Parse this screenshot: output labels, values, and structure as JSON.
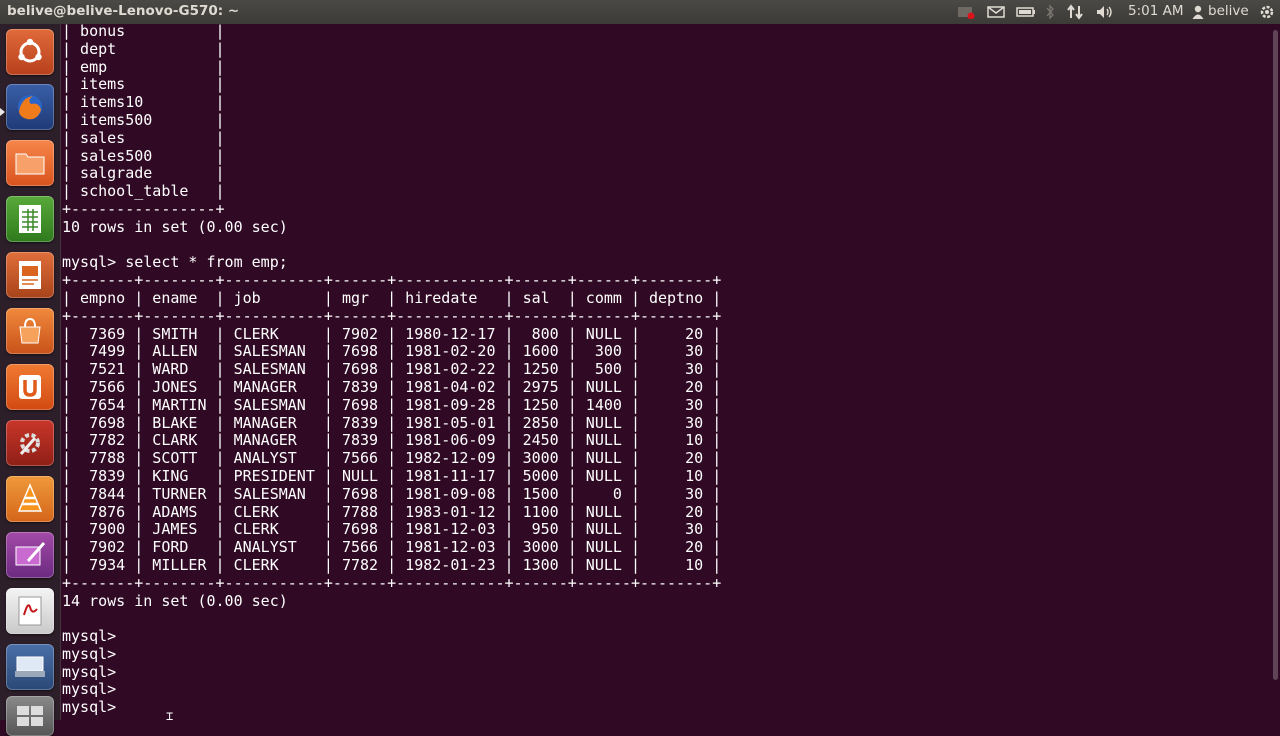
{
  "window_title": "belive@belive-Lenovo-G570: ~",
  "panel": {
    "clock": "5:01 AM",
    "user": "belive"
  },
  "launcher": [
    "ubuntu-dash",
    "firefox",
    "files",
    "libreoffice-calc",
    "libreoffice-impress",
    "ubuntu-software-center",
    "ubuntu-one",
    "system-settings",
    "vlc",
    "kdenlive",
    "document-viewer",
    "scanner",
    "workspace-switcher"
  ],
  "terminal": {
    "lines": [
      "| bonus          |",
      "| dept           |",
      "| emp            |",
      "| items          |",
      "| items10        |",
      "| items500       |",
      "| sales          |",
      "| sales500       |",
      "| salgrade       |",
      "| school_table   |",
      "+----------------+",
      "10 rows in set (0.00 sec)",
      "",
      "mysql> select * from emp;",
      "+-------+--------+-----------+------+------------+------+------+--------+",
      "| empno | ename  | job       | mgr  | hiredate   | sal  | comm | deptno |",
      "+-------+--------+-----------+------+------------+------+------+--------+",
      "|  7369 | SMITH  | CLERK     | 7902 | 1980-12-17 |  800 | NULL |     20 |",
      "|  7499 | ALLEN  | SALESMAN  | 7698 | 1981-02-20 | 1600 |  300 |     30 |",
      "|  7521 | WARD   | SALESMAN  | 7698 | 1981-02-22 | 1250 |  500 |     30 |",
      "|  7566 | JONES  | MANAGER   | 7839 | 1981-04-02 | 2975 | NULL |     20 |",
      "|  7654 | MARTIN | SALESMAN  | 7698 | 1981-09-28 | 1250 | 1400 |     30 |",
      "|  7698 | BLAKE  | MANAGER   | 7839 | 1981-05-01 | 2850 | NULL |     30 |",
      "|  7782 | CLARK  | MANAGER   | 7839 | 1981-06-09 | 2450 | NULL |     10 |",
      "|  7788 | SCOTT  | ANALYST   | 7566 | 1982-12-09 | 3000 | NULL |     20 |",
      "|  7839 | KING   | PRESIDENT | NULL | 1981-11-17 | 5000 | NULL |     10 |",
      "|  7844 | TURNER | SALESMAN  | 7698 | 1981-09-08 | 1500 |    0 |     30 |",
      "|  7876 | ADAMS  | CLERK     | 7788 | 1983-01-12 | 1100 | NULL |     20 |",
      "|  7900 | JAMES  | CLERK     | 7698 | 1981-12-03 |  950 | NULL |     30 |",
      "|  7902 | FORD   | ANALYST   | 7566 | 1981-12-03 | 3000 | NULL |     20 |",
      "|  7934 | MILLER | CLERK     | 7782 | 1982-01-23 | 1300 | NULL |     10 |",
      "+-------+--------+-----------+------+------------+------+------+--------+",
      "14 rows in set (0.00 sec)",
      "",
      "mysql>",
      "mysql>",
      "mysql>",
      "mysql>",
      "mysql>"
    ]
  },
  "colors": {
    "terminal_bg": "#300a24",
    "terminal_fg": "#ffffff",
    "panel_bg": "#3c3b37",
    "launcher_bg": "#2d1f2a"
  }
}
